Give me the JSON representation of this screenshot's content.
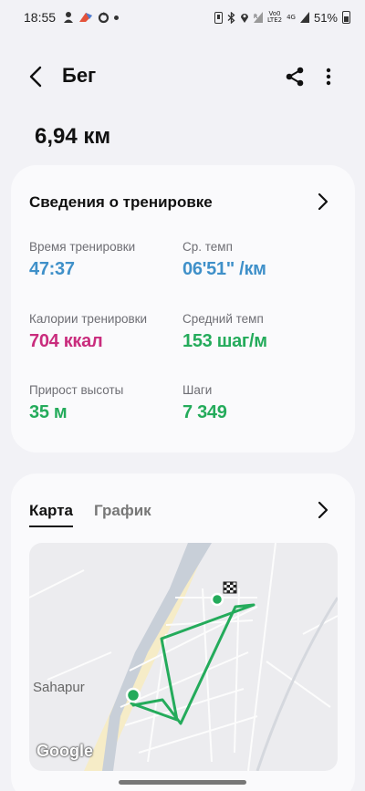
{
  "status": {
    "time": "18:55",
    "battery": "51%",
    "net_top": "Vo0",
    "net_bottom": "LTE2",
    "sig": "4G"
  },
  "header": {
    "title": "Бег"
  },
  "summary": {
    "distance": "6,94 км"
  },
  "workout": {
    "title": "Сведения о тренировке",
    "stats": [
      {
        "label": "Время тренировки",
        "value": "47:37",
        "color": "#3f90c9"
      },
      {
        "label": "Ср. темп",
        "value": "06'51\" /км",
        "color": "#3f90c9"
      },
      {
        "label": "Калории тренировки",
        "value": "704 ккал",
        "color": "#c92c7d"
      },
      {
        "label": "Средний темп",
        "value": "153 шаг/м",
        "color": "#24ab5b"
      },
      {
        "label": "Прирост высоты",
        "value": "35 м",
        "color": "#24ab5b"
      },
      {
        "label": "Шаги",
        "value": "7 349",
        "color": "#24ab5b"
      }
    ]
  },
  "map_card": {
    "tabs": [
      {
        "label": "Карта",
        "active": true
      },
      {
        "label": "График",
        "active": false
      }
    ],
    "place_label": "Sahapur",
    "attribution": "Google"
  },
  "colors": {
    "route": "#24ab5b",
    "accent_blue": "#3f90c9",
    "accent_pink": "#c92c7d"
  }
}
